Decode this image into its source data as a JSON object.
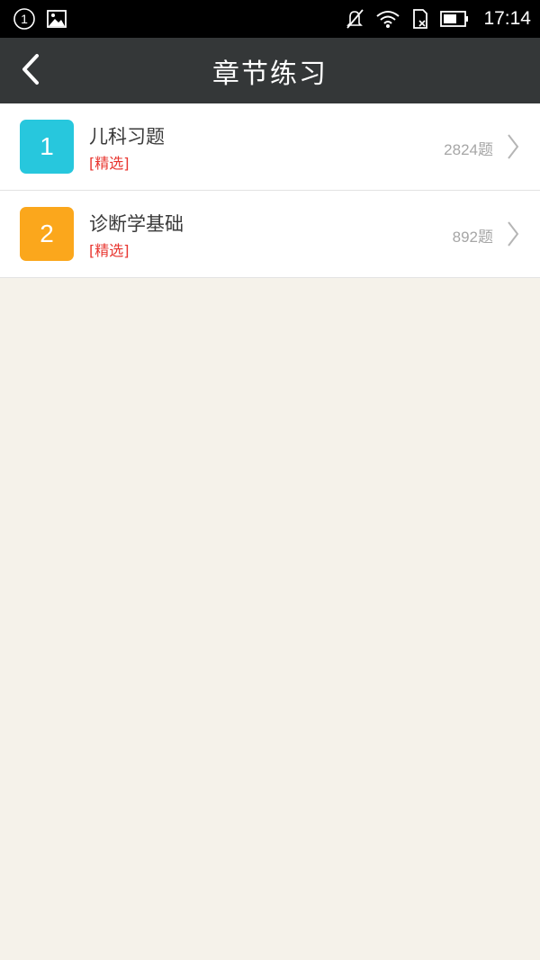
{
  "status_bar": {
    "notification_badge": "1",
    "time": "17:14",
    "icons": [
      "circle-one-icon",
      "image-icon",
      "mute-icon",
      "wifi-icon",
      "no-sim-icon",
      "battery-icon"
    ]
  },
  "header": {
    "title": "章节练习",
    "back_icon": "back-chevron-icon"
  },
  "chapters": [
    {
      "number": "1",
      "title": "儿科习题",
      "tag": "[精选]",
      "count": "2824题",
      "color": "#27c7dd"
    },
    {
      "number": "2",
      "title": "诊断学基础",
      "tag": "[精选]",
      "count": "892题",
      "color": "#fba71c"
    }
  ],
  "colors": {
    "header_bg": "#343738",
    "page_bg": "#f5f2ea",
    "tag_red": "#e8352f"
  }
}
